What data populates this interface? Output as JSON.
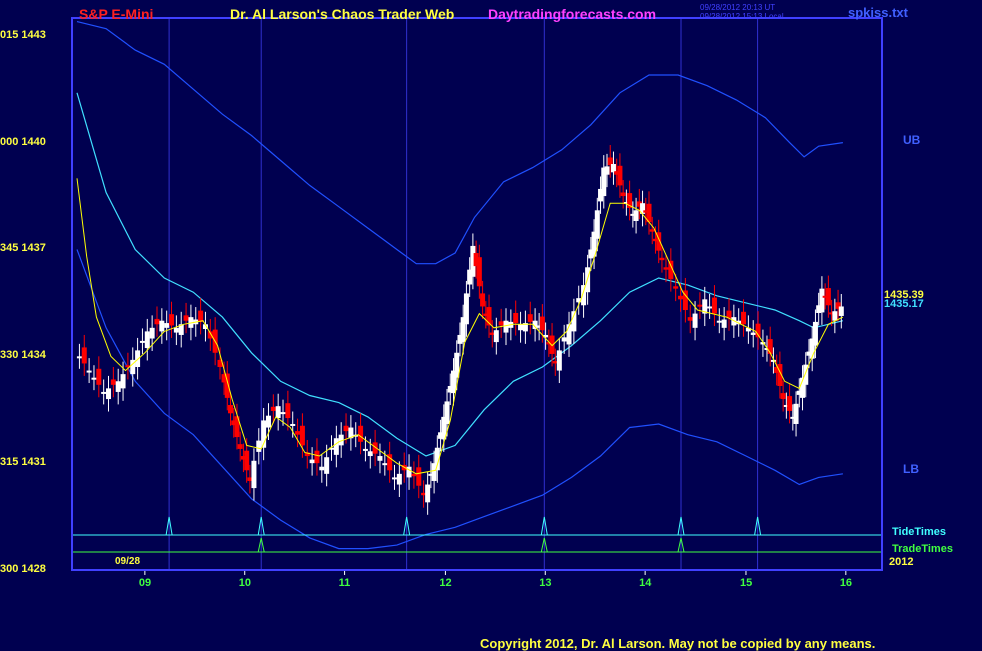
{
  "header": {
    "market": "S&P E-Mini",
    "title": "Dr. Al Larson's Chaos Trader Web",
    "site": "Daytradingforecasts.com",
    "timestamp_ut": "09/28/2012 20:13 UT",
    "timestamp_local": "09/28/2012 15:13 Local",
    "file": "spkiss.txt"
  },
  "footer": "Copyright 2012, Dr. Al Larson. May not be copied by any means.",
  "y_ticks": [
    {
      "left": "015",
      "value": "1443",
      "price": 1443
    },
    {
      "left": "000",
      "value": "1440",
      "price": 1440
    },
    {
      "left": "345",
      "value": "1437",
      "price": 1437
    },
    {
      "left": "330",
      "value": "1434",
      "price": 1434
    },
    {
      "left": "315",
      "value": "1431",
      "price": 1431
    },
    {
      "left": "300",
      "value": "1428",
      "price": 1428
    }
  ],
  "x_ticks": [
    {
      "label": "09",
      "pos": 0.7
    },
    {
      "label": "10",
      "pos": 1.73
    },
    {
      "label": "11",
      "pos": 2.76
    },
    {
      "label": "12",
      "pos": 3.8
    },
    {
      "label": "13",
      "pos": 4.83
    },
    {
      "label": "14",
      "pos": 5.86
    },
    {
      "label": "15",
      "pos": 6.9
    },
    {
      "label": "16",
      "pos": 7.93
    }
  ],
  "date_label": "09/28",
  "year_label": "2012",
  "labels": {
    "ub": "UB",
    "lb": "LB",
    "tide": "TideTimes",
    "trade": "TradeTimes",
    "price1": "1435.39",
    "price2": "1435.17"
  },
  "colors": {
    "background": "#000050",
    "frame": "#4040ff",
    "up": "#ffffff",
    "down": "#ff0000",
    "ema": "#ffff00",
    "mid_band": "#40e0ff",
    "outer_band": "#2050ff",
    "tide": "#40ffff",
    "trade": "#40ff40"
  },
  "chart_data": {
    "type": "line",
    "title": "S&P E-Mini",
    "ylim": [
      1428,
      1443.5
    ],
    "xlim": [
      0,
      8.2
    ],
    "price_close": [
      [
        0,
        1434.2
      ],
      [
        0.15,
        1433.6
      ],
      [
        0.3,
        1433.0
      ],
      [
        0.45,
        1433.3
      ],
      [
        0.6,
        1433.9
      ],
      [
        0.75,
        1434.7
      ],
      [
        0.9,
        1435.0
      ],
      [
        1.05,
        1434.8
      ],
      [
        1.2,
        1435.1
      ],
      [
        1.35,
        1434.9
      ],
      [
        1.5,
        1433.7
      ],
      [
        1.6,
        1432.4
      ],
      [
        1.7,
        1431.4
      ],
      [
        1.8,
        1430.5
      ],
      [
        1.95,
        1432.2
      ],
      [
        2.1,
        1432.6
      ],
      [
        2.25,
        1432.1
      ],
      [
        2.4,
        1431.2
      ],
      [
        2.55,
        1430.9
      ],
      [
        2.7,
        1431.7
      ],
      [
        2.85,
        1432.0
      ],
      [
        3.0,
        1431.4
      ],
      [
        3.15,
        1431.2
      ],
      [
        3.3,
        1430.6
      ],
      [
        3.45,
        1430.9
      ],
      [
        3.6,
        1430.1
      ],
      [
        3.7,
        1431.0
      ],
      [
        3.8,
        1432.3
      ],
      [
        3.9,
        1433.6
      ],
      [
        4.0,
        1435.1
      ],
      [
        4.1,
        1437.1
      ],
      [
        4.2,
        1435.4
      ],
      [
        4.3,
        1434.6
      ],
      [
        4.45,
        1435.0
      ],
      [
        4.6,
        1434.9
      ],
      [
        4.75,
        1435.0
      ],
      [
        4.85,
        1434.6
      ],
      [
        4.95,
        1433.8
      ],
      [
        5.1,
        1434.9
      ],
      [
        5.25,
        1436.0
      ],
      [
        5.35,
        1437.5
      ],
      [
        5.45,
        1439.3
      ],
      [
        5.55,
        1439.4
      ],
      [
        5.65,
        1438.5
      ],
      [
        5.75,
        1438.0
      ],
      [
        5.85,
        1438.3
      ],
      [
        5.95,
        1437.5
      ],
      [
        6.05,
        1436.7
      ],
      [
        6.2,
        1435.9
      ],
      [
        6.35,
        1435.0
      ],
      [
        6.5,
        1435.6
      ],
      [
        6.65,
        1435.0
      ],
      [
        6.8,
        1435.1
      ],
      [
        6.95,
        1434.8
      ],
      [
        7.1,
        1434.4
      ],
      [
        7.2,
        1433.9
      ],
      [
        7.3,
        1432.8
      ],
      [
        7.4,
        1432.3
      ],
      [
        7.5,
        1433.4
      ],
      [
        7.6,
        1434.5
      ],
      [
        7.7,
        1435.9
      ],
      [
        7.8,
        1435.2
      ],
      [
        7.9,
        1435.4
      ]
    ],
    "ema": [
      [
        0,
        1439.0
      ],
      [
        0.1,
        1436.8
      ],
      [
        0.2,
        1435.1
      ],
      [
        0.35,
        1434.0
      ],
      [
        0.5,
        1433.6
      ],
      [
        0.7,
        1434.1
      ],
      [
        0.9,
        1434.7
      ],
      [
        1.1,
        1434.9
      ],
      [
        1.3,
        1435.0
      ],
      [
        1.45,
        1434.3
      ],
      [
        1.6,
        1432.8
      ],
      [
        1.75,
        1431.5
      ],
      [
        1.9,
        1431.4
      ],
      [
        2.05,
        1432.3
      ],
      [
        2.2,
        1432.0
      ],
      [
        2.35,
        1431.3
      ],
      [
        2.5,
        1431.2
      ],
      [
        2.7,
        1431.6
      ],
      [
        2.9,
        1431.8
      ],
      [
        3.1,
        1431.4
      ],
      [
        3.3,
        1431.0
      ],
      [
        3.5,
        1430.7
      ],
      [
        3.7,
        1430.8
      ],
      [
        3.85,
        1432.2
      ],
      [
        4.0,
        1434.4
      ],
      [
        4.15,
        1435.2
      ],
      [
        4.3,
        1434.8
      ],
      [
        4.5,
        1434.9
      ],
      [
        4.7,
        1434.9
      ],
      [
        4.9,
        1434.3
      ],
      [
        5.05,
        1434.7
      ],
      [
        5.2,
        1435.6
      ],
      [
        5.35,
        1436.9
      ],
      [
        5.5,
        1438.3
      ],
      [
        5.65,
        1438.3
      ],
      [
        5.8,
        1438.1
      ],
      [
        5.95,
        1437.6
      ],
      [
        6.1,
        1436.7
      ],
      [
        6.25,
        1435.8
      ],
      [
        6.4,
        1435.3
      ],
      [
        6.55,
        1435.2
      ],
      [
        6.7,
        1435.1
      ],
      [
        6.85,
        1434.9
      ],
      [
        7.0,
        1434.7
      ],
      [
        7.15,
        1434.1
      ],
      [
        7.3,
        1433.3
      ],
      [
        7.45,
        1433.1
      ],
      [
        7.6,
        1434.1
      ],
      [
        7.75,
        1434.9
      ],
      [
        7.9,
        1435.1
      ]
    ],
    "mid_band": [
      [
        0,
        1441.4
      ],
      [
        0.3,
        1438.6
      ],
      [
        0.6,
        1437.0
      ],
      [
        0.9,
        1436.2
      ],
      [
        1.2,
        1435.8
      ],
      [
        1.5,
        1435.1
      ],
      [
        1.8,
        1434.1
      ],
      [
        2.1,
        1433.3
      ],
      [
        2.4,
        1432.9
      ],
      [
        2.7,
        1432.7
      ],
      [
        3.0,
        1432.3
      ],
      [
        3.3,
        1431.7
      ],
      [
        3.6,
        1431.2
      ],
      [
        3.9,
        1431.5
      ],
      [
        4.2,
        1432.5
      ],
      [
        4.5,
        1433.3
      ],
      [
        4.8,
        1433.7
      ],
      [
        5.1,
        1434.3
      ],
      [
        5.4,
        1435.0
      ],
      [
        5.7,
        1435.8
      ],
      [
        6.0,
        1436.2
      ],
      [
        6.3,
        1436.0
      ],
      [
        6.6,
        1435.7
      ],
      [
        6.9,
        1435.5
      ],
      [
        7.2,
        1435.3
      ],
      [
        7.45,
        1435.0
      ],
      [
        7.6,
        1434.8
      ],
      [
        7.75,
        1434.9
      ],
      [
        7.9,
        1435.0
      ]
    ],
    "upper_band": [
      [
        0,
        1443.4
      ],
      [
        0.3,
        1443.2
      ],
      [
        0.6,
        1442.6
      ],
      [
        0.9,
        1442.2
      ],
      [
        1.2,
        1441.5
      ],
      [
        1.5,
        1440.8
      ],
      [
        1.8,
        1440.2
      ],
      [
        2.1,
        1439.5
      ],
      [
        2.4,
        1438.8
      ],
      [
        2.7,
        1438.2
      ],
      [
        3.0,
        1437.6
      ],
      [
        3.3,
        1437.0
      ],
      [
        3.5,
        1436.6
      ],
      [
        3.7,
        1436.6
      ],
      [
        3.9,
        1436.9
      ],
      [
        4.1,
        1437.9
      ],
      [
        4.4,
        1438.9
      ],
      [
        4.7,
        1439.3
      ],
      [
        5.0,
        1439.8
      ],
      [
        5.3,
        1440.5
      ],
      [
        5.6,
        1441.4
      ],
      [
        5.9,
        1441.9
      ],
      [
        6.2,
        1441.9
      ],
      [
        6.5,
        1441.6
      ],
      [
        6.8,
        1441.2
      ],
      [
        7.1,
        1440.7
      ],
      [
        7.35,
        1440.0
      ],
      [
        7.5,
        1439.6
      ],
      [
        7.65,
        1439.9
      ],
      [
        7.9,
        1440.0
      ]
    ],
    "lower_band": [
      [
        0,
        1437.0
      ],
      [
        0.3,
        1434.8
      ],
      [
        0.6,
        1433.3
      ],
      [
        0.9,
        1432.4
      ],
      [
        1.2,
        1431.8
      ],
      [
        1.5,
        1430.9
      ],
      [
        1.8,
        1430.0
      ],
      [
        2.1,
        1429.4
      ],
      [
        2.4,
        1428.9
      ],
      [
        2.7,
        1428.6
      ],
      [
        3.0,
        1428.6
      ],
      [
        3.3,
        1428.7
      ],
      [
        3.6,
        1429.0
      ],
      [
        3.9,
        1429.2
      ],
      [
        4.2,
        1429.5
      ],
      [
        4.5,
        1429.8
      ],
      [
        4.8,
        1430.1
      ],
      [
        5.1,
        1430.6
      ],
      [
        5.4,
        1431.2
      ],
      [
        5.7,
        1432.0
      ],
      [
        6.0,
        1432.1
      ],
      [
        6.3,
        1431.8
      ],
      [
        6.6,
        1431.6
      ],
      [
        6.9,
        1431.2
      ],
      [
        7.2,
        1430.8
      ],
      [
        7.45,
        1430.4
      ],
      [
        7.65,
        1430.6
      ],
      [
        7.9,
        1430.7
      ]
    ],
    "tide_times": [
      0.95,
      1.9,
      3.4,
      4.82,
      6.23,
      7.02
    ],
    "trade_times": [
      1.9,
      4.82,
      6.23
    ],
    "last_prices": [
      1435.39,
      1435.17
    ]
  }
}
